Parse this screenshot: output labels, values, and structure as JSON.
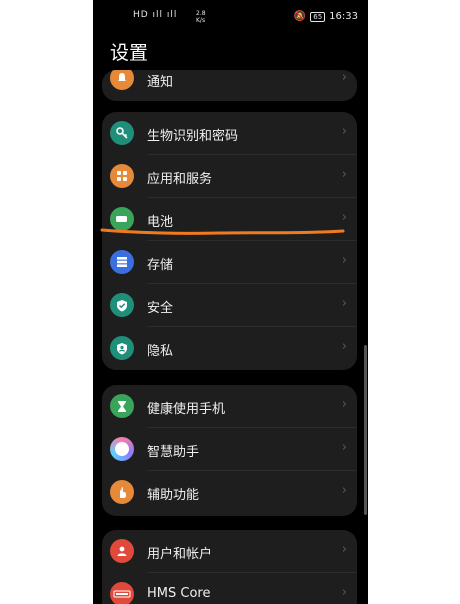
{
  "status_bar": {
    "signal": "HD ıll ıll",
    "speed_value": "2.8",
    "speed_unit": "K/s",
    "battery": "65",
    "time": "16:33"
  },
  "page_title": "设置",
  "groups": [
    {
      "items": [
        {
          "label": "通知",
          "icon": "bell-icon",
          "color": "#e68a3a"
        }
      ]
    },
    {
      "items": [
        {
          "label": "生物识别和密码",
          "icon": "key-icon",
          "color": "#1f8f7a"
        },
        {
          "label": "应用和服务",
          "icon": "apps-grid-icon",
          "color": "#e68a3a"
        },
        {
          "label": "电池",
          "icon": "battery-icon",
          "color": "#3aa55a"
        },
        {
          "label": "存储",
          "icon": "storage-icon",
          "color": "#3b6fe0"
        },
        {
          "label": "安全",
          "icon": "shield-check-icon",
          "color": "#1f8f7a"
        },
        {
          "label": "隐私",
          "icon": "privacy-shield-icon",
          "color": "#1f8f7a"
        }
      ]
    },
    {
      "items": [
        {
          "label": "健康使用手机",
          "icon": "hourglass-icon",
          "color": "#3aa55a"
        },
        {
          "label": "智慧助手",
          "icon": "assistant-icon",
          "color": "#ffffff"
        },
        {
          "label": "辅助功能",
          "icon": "hand-icon",
          "color": "#e68a3a"
        }
      ]
    },
    {
      "items": [
        {
          "label": "用户和帐户",
          "icon": "user-icon",
          "color": "#e04a3a"
        },
        {
          "label": "HMS Core",
          "icon": "hms-icon",
          "color": "#e04a3a"
        }
      ]
    }
  ],
  "annotation_color": "#f07a20"
}
